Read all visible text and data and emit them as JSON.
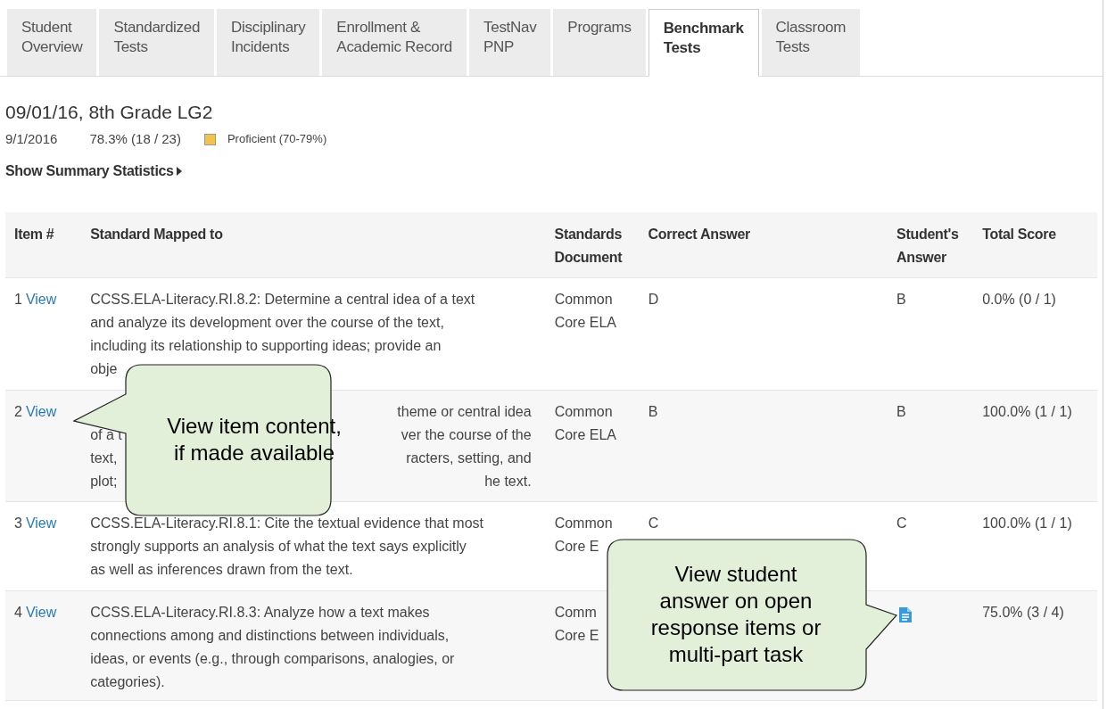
{
  "tabs": [
    {
      "label": "Student\nOverview",
      "selected": false
    },
    {
      "label": "Standardized\nTests",
      "selected": false
    },
    {
      "label": "Disciplinary\nIncidents",
      "selected": false
    },
    {
      "label": "Enrollment &\nAcademic Record",
      "selected": false
    },
    {
      "label": "TestNav\nPNP",
      "selected": false
    },
    {
      "label": "Programs",
      "selected": false
    },
    {
      "label": "Benchmark\nTests",
      "selected": true
    },
    {
      "label": "Classroom\nTests",
      "selected": false
    }
  ],
  "test": {
    "title": "09/01/16, 8th Grade LG2",
    "date": "9/1/2016",
    "score": "78.3% (18 / 23)",
    "level": {
      "label": "Proficient (70-79%)",
      "color": "#f2c250"
    },
    "summary_link": "Show Summary Statistics"
  },
  "table": {
    "columns": [
      "Item #",
      "Standard Mapped to",
      "Standards\nDocument",
      "Correct Answer",
      "Student's\nAnswer",
      "Total Score"
    ],
    "rows": [
      {
        "item": "1",
        "view": "View",
        "standard": [
          {
            "text": "CCSS.ELA-Literacy.RI.8.2: Determine a central idea of a text"
          },
          {
            "text": "and analyze its development over the course of the text,"
          },
          {
            "text": "including its relationship to supporting ideas; provide an"
          },
          {
            "text": "obje"
          }
        ],
        "document": [
          "Common",
          "Core ELA"
        ],
        "correct": "D",
        "student_answer": {
          "kind": "text",
          "text": "B"
        },
        "total": "0.0% (0 / 1)"
      },
      {
        "item": "2",
        "view": "View",
        "standard": [
          {
            "right": "theme or central idea"
          },
          {
            "left": "of a t",
            "right": "ver the course of the"
          },
          {
            "left": "text,",
            "right": "racters, setting, and"
          },
          {
            "left": "plot;",
            "right": "he text."
          }
        ],
        "document": [
          "Common",
          "Core ELA"
        ],
        "correct": "B",
        "student_answer": {
          "kind": "text",
          "text": "B"
        },
        "total": "100.0% (1 / 1)"
      },
      {
        "item": "3",
        "view": "View",
        "standard": [
          {
            "text": "CCSS.ELA-Literacy.RI.8.1: Cite the textual evidence that most"
          },
          {
            "text": "strongly supports an analysis of what the text says explicitly"
          },
          {
            "text": "as well as inferences drawn from the text."
          }
        ],
        "document": [
          "Common",
          "Core E"
        ],
        "correct": "C",
        "student_answer": {
          "kind": "text",
          "text": "C"
        },
        "total": "100.0% (1 / 1)"
      },
      {
        "item": "4",
        "view": "View",
        "standard": [
          {
            "text": "CCSS.ELA-Literacy.RI.8.3: Analyze how a text makes"
          },
          {
            "text": "connections among and distinctions between individuals,"
          },
          {
            "text": "ideas, or events (e.g., through comparisons, analogies, or"
          },
          {
            "text": "categories)."
          }
        ],
        "document": [
          "Comm",
          "Core E"
        ],
        "student_answer": {
          "kind": "icon"
        },
        "total": "75.0% (3 / 4)"
      }
    ]
  },
  "callouts": [
    "View item content,\nif made available",
    "View student\nanswer on open\nresponse items or\nmulti-part task"
  ]
}
